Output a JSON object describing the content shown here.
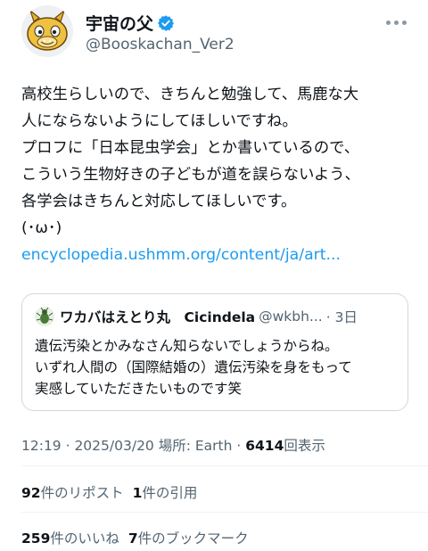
{
  "tweet": {
    "display_name": "宇宙の父",
    "handle": "@Booskachan_Ver2",
    "body_lines": [
      "高校生らしいので、きちんと勉強して、馬鹿な大",
      "人にならないようにしてほしいですね。",
      "プロフに「日本昆虫学会」とか書いているので、",
      "こういう生物好きの子どもが道を誤らないよう、",
      "各学会はきちんと対応してほしいです。",
      "(･ω･)"
    ],
    "link": "encyclopedia.ushmm.org/content/ja/art..."
  },
  "quote": {
    "name": "ワカバはえとり丸　Cicindela",
    "handle": "@wkbh...",
    "time": "· 3日",
    "body_lines": [
      "遺伝汚染とかみなさん知らないでしょうからね。",
      "いずれ人間の（国際結婚の）遺伝汚染を身をもって",
      "実感していただきたいものです笑"
    ]
  },
  "meta": {
    "datetime": "12:19 · 2025/03/20 場所: Earth · ",
    "views": "6414",
    "views_label": "回表示"
  },
  "stats": {
    "reposts_count": "92",
    "reposts_label": "件のリポスト",
    "quotes_count": "1",
    "quotes_label": "件の引用",
    "likes_count": "259",
    "likes_label": "件のいいね",
    "bookmarks_count": "7",
    "bookmarks_label": "件のブックマーク"
  },
  "colors": {
    "link": "#1d9bf0",
    "verified": "#1d9bf0",
    "secondary_text": "#536471",
    "border": "#cfd9de"
  },
  "icons": {
    "verified": "verified-badge-icon",
    "more": "more-options-icon"
  }
}
